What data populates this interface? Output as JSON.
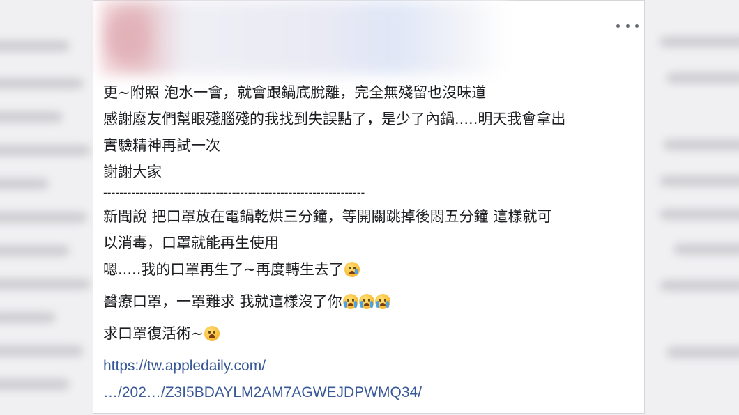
{
  "post": {
    "lines_a": [
      "更~附照 泡水一會，就會跟鍋底脫離，完全無殘留也沒味道",
      "感謝廢友們幫眼殘腦殘的我找到失誤點了，是少了內鍋.....明天我會拿出",
      "實驗精神再試一次",
      "謝謝大家"
    ],
    "divider": "-----------------------------------------------------------------",
    "lines_b": [
      "新聞說 把口罩放在電鍋乾烘三分鐘，等開關跳掉後悶五分鐘 這樣就可",
      "以消毒，口罩就能再生使用",
      "嗯.....我的口罩再生了~再度轉生去了"
    ],
    "line_c": "醫療口罩，一罩難求 我就這樣沒了你",
    "line_d": "求口罩復活術~",
    "link_line_1": "https://tw.appledaily.com/",
    "link_line_2": "…/202…/Z3I5BDAYLM2AM7AGWEJDPWMQ34/",
    "emoji": {
      "sad_tear": "crying-face",
      "loud_cry": "loudly-crying-face",
      "tired": "tired-face"
    }
  },
  "menu": {
    "more_icon": "more-horizontal-icon"
  }
}
